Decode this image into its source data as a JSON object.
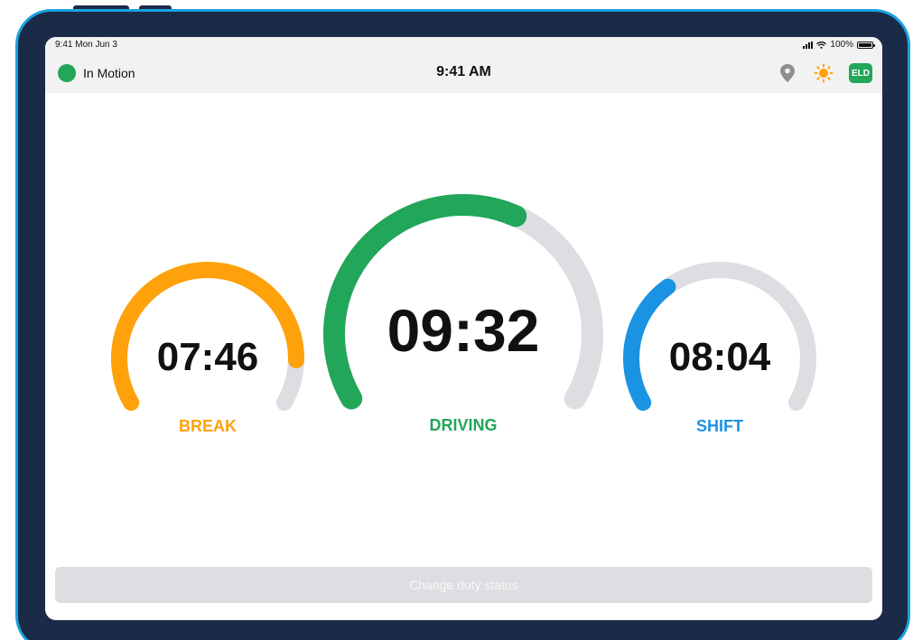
{
  "status_bar": {
    "time_date": "9:41 Mon Jun 3",
    "battery": "100%"
  },
  "nav_bar": {
    "status_label": "In Motion",
    "clock": "9:41 AM",
    "eld_label": "ELD"
  },
  "gauges": [
    {
      "key": "break",
      "time": "07:46",
      "label": "BREAK",
      "color": "#ffa10a",
      "fraction": 0.88
    },
    {
      "key": "driving",
      "time": "09:32",
      "label": "DRIVING",
      "color": "#22a65a",
      "fraction": 0.6
    },
    {
      "key": "shift",
      "time": "08:04",
      "label": "SHIFT",
      "color": "#1a93e3",
      "fraction": 0.35
    }
  ],
  "track_color": "#dddde2",
  "actions": {
    "change_duty_status": "Change duty status"
  }
}
